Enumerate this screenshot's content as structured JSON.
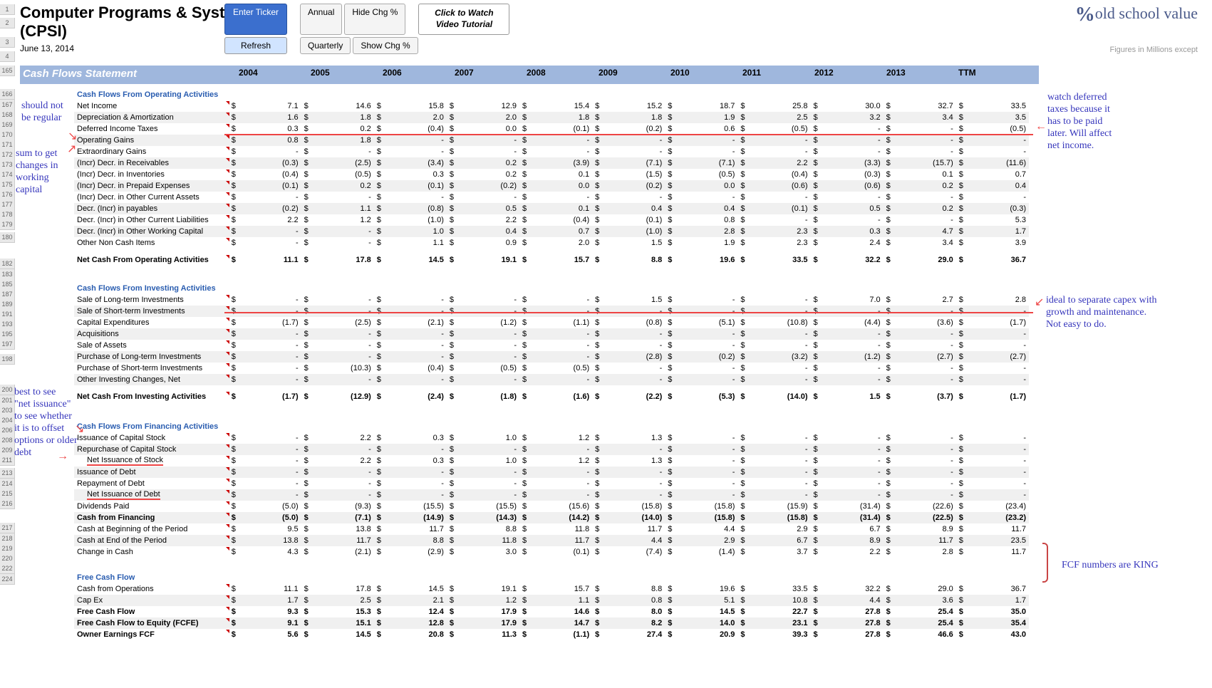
{
  "header": {
    "title": "Computer Programs & Systems Inc.",
    "ticker": "(CPSI)",
    "date": "June 13, 2014",
    "logo_text": "old school value",
    "figures": "Figures in Millions except"
  },
  "buttons": {
    "enter_ticker": "Enter Ticker",
    "refresh": "Refresh",
    "annual": "Annual",
    "quarterly": "Quarterly",
    "hide": "Hide Chg %",
    "show": "Show Chg %",
    "tutorial": "Click to Watch Video Tutorial"
  },
  "section_title": "Cash Flows Statement",
  "years": [
    "2004",
    "2005",
    "2006",
    "2007",
    "2008",
    "2009",
    "2010",
    "2011",
    "2012",
    "2013",
    "TTM"
  ],
  "sections": {
    "op_hdr": "Cash Flows From Operating Activities",
    "inv_hdr": "Cash Flows From Investing Activities",
    "fin_hdr": "Cash Flows From Financing Activities",
    "fcf_hdr": "Free Cash Flow"
  },
  "rows": {
    "net_income": {
      "label": "Net Income",
      "v": [
        "7.1",
        "14.6",
        "15.8",
        "12.9",
        "15.4",
        "15.2",
        "18.7",
        "25.8",
        "30.0",
        "32.7",
        "33.5"
      ]
    },
    "depr": {
      "label": "Depreciation & Amortization",
      "v": [
        "1.6",
        "1.8",
        "2.0",
        "2.0",
        "1.8",
        "1.8",
        "1.9",
        "2.5",
        "3.2",
        "3.4",
        "3.5"
      ]
    },
    "def_tax": {
      "label": "Deferred Income Taxes",
      "v": [
        "0.3",
        "0.2",
        "(0.4)",
        "0.0",
        "(0.1)",
        "(0.2)",
        "0.6",
        "(0.5)",
        "-",
        "-",
        "(0.5)"
      ]
    },
    "op_gains": {
      "label": "Operating Gains",
      "v": [
        "0.8",
        "1.8",
        "-",
        "-",
        "-",
        "-",
        "-",
        "-",
        "-",
        "-",
        "-"
      ]
    },
    "ext_gains": {
      "label": "Extraordinary Gains",
      "v": [
        "-",
        "-",
        "-",
        "-",
        "-",
        "-",
        "-",
        "-",
        "-",
        "-",
        "-"
      ]
    },
    "recv": {
      "label": "(Incr) Decr. in Receivables",
      "v": [
        "(0.3)",
        "(2.5)",
        "(3.4)",
        "0.2",
        "(3.9)",
        "(7.1)",
        "(7.1)",
        "2.2",
        "(3.3)",
        "(15.7)",
        "(11.6)"
      ]
    },
    "inv": {
      "label": "(Incr) Decr. in Inventories",
      "v": [
        "(0.4)",
        "(0.5)",
        "0.3",
        "0.2",
        "0.1",
        "(1.5)",
        "(0.5)",
        "(0.4)",
        "(0.3)",
        "0.1",
        "0.7"
      ]
    },
    "prep": {
      "label": "(Incr) Decr. in Prepaid Expenses",
      "v": [
        "(0.1)",
        "0.2",
        "(0.1)",
        "(0.2)",
        "0.0",
        "(0.2)",
        "0.0",
        "(0.6)",
        "(0.6)",
        "0.2",
        "0.4"
      ]
    },
    "oca": {
      "label": "(Incr) Decr. in Other Current Assets",
      "v": [
        "-",
        "-",
        "-",
        "-",
        "-",
        "-",
        "-",
        "-",
        "-",
        "-",
        "-"
      ]
    },
    "pay": {
      "label": "Decr. (Incr) in payables",
      "v": [
        "(0.2)",
        "1.1",
        "(0.8)",
        "0.5",
        "0.1",
        "0.4",
        "0.4",
        "(0.1)",
        "0.5",
        "0.2",
        "(0.3)"
      ]
    },
    "ocl": {
      "label": "Decr. (Incr) in Other Current Liabilities",
      "v": [
        "2.2",
        "1.2",
        "(1.0)",
        "2.2",
        "(0.4)",
        "(0.1)",
        "0.8",
        "-",
        "-",
        "-",
        "5.3"
      ]
    },
    "owc": {
      "label": "Decr. (Incr) in Other Working Capital",
      "v": [
        "-",
        "-",
        "1.0",
        "0.4",
        "0.7",
        "(1.0)",
        "2.8",
        "2.3",
        "0.3",
        "4.7",
        "1.7"
      ]
    },
    "onc": {
      "label": "Other Non Cash Items",
      "v": [
        "-",
        "-",
        "1.1",
        "0.9",
        "2.0",
        "1.5",
        "1.9",
        "2.3",
        "2.4",
        "3.4",
        "3.9"
      ]
    },
    "net_op": {
      "label": "Net Cash From Operating Activities",
      "v": [
        "11.1",
        "17.8",
        "14.5",
        "19.1",
        "15.7",
        "8.8",
        "19.6",
        "33.5",
        "32.2",
        "29.0",
        "36.7"
      ]
    },
    "sale_lt": {
      "label": "Sale of Long-term Investments",
      "v": [
        "-",
        "-",
        "-",
        "-",
        "-",
        "1.5",
        "-",
        "-",
        "7.0",
        "2.7",
        "2.8"
      ]
    },
    "sale_st": {
      "label": "Sale of Short-term Investments",
      "v": [
        "-",
        "-",
        "-",
        "-",
        "-",
        "-",
        "-",
        "-",
        "-",
        "-",
        "-"
      ]
    },
    "capex": {
      "label": "Capital Expenditures",
      "v": [
        "(1.7)",
        "(2.5)",
        "(2.1)",
        "(1.2)",
        "(1.1)",
        "(0.8)",
        "(5.1)",
        "(10.8)",
        "(4.4)",
        "(3.6)",
        "(1.7)"
      ]
    },
    "acq": {
      "label": "Acquisitions",
      "v": [
        "-",
        "-",
        "-",
        "-",
        "-",
        "-",
        "-",
        "-",
        "-",
        "-",
        "-"
      ]
    },
    "sale_assets": {
      "label": "Sale of Assets",
      "v": [
        "-",
        "-",
        "-",
        "-",
        "-",
        "-",
        "-",
        "-",
        "-",
        "-",
        "-"
      ]
    },
    "pur_lt": {
      "label": "Purchase of Long-term Investments",
      "v": [
        "-",
        "-",
        "-",
        "-",
        "-",
        "(2.8)",
        "(0.2)",
        "(3.2)",
        "(1.2)",
        "(2.7)",
        "(2.7)"
      ]
    },
    "pur_st": {
      "label": "Purchase of  Short-term Investments",
      "v": [
        "-",
        "(10.3)",
        "(0.4)",
        "(0.5)",
        "(0.5)",
        "-",
        "-",
        "-",
        "-",
        "-",
        "-"
      ]
    },
    "other_inv": {
      "label": "Other Investing Changes, Net",
      "v": [
        "-",
        "-",
        "-",
        "-",
        "-",
        "-",
        "-",
        "-",
        "-",
        "-",
        "-"
      ]
    },
    "net_inv": {
      "label": "Net Cash From Investing Activities",
      "v": [
        "(1.7)",
        "(12.9)",
        "(2.4)",
        "(1.8)",
        "(1.6)",
        "(2.2)",
        "(5.3)",
        "(14.0)",
        "1.5",
        "(3.7)",
        "(1.7)"
      ]
    },
    "iss_cap": {
      "label": "Issuance of Capital Stock",
      "v": [
        "-",
        "2.2",
        "0.3",
        "1.0",
        "1.2",
        "1.3",
        "-",
        "-",
        "-",
        "-",
        "-"
      ]
    },
    "rep_cap": {
      "label": "Repurchase of Capital Stock",
      "v": [
        "-",
        "-",
        "-",
        "-",
        "-",
        "-",
        "-",
        "-",
        "-",
        "-",
        "-"
      ]
    },
    "net_stock": {
      "label": "Net Issuance of Stock",
      "v": [
        "-",
        "2.2",
        "0.3",
        "1.0",
        "1.2",
        "1.3",
        "-",
        "-",
        "-",
        "-",
        "-"
      ]
    },
    "iss_debt": {
      "label": "Issuance of Debt",
      "v": [
        "-",
        "-",
        "-",
        "-",
        "-",
        "-",
        "-",
        "-",
        "-",
        "-",
        "-"
      ]
    },
    "rep_debt": {
      "label": "Repayment of Debt",
      "v": [
        "-",
        "-",
        "-",
        "-",
        "-",
        "-",
        "-",
        "-",
        "-",
        "-",
        "-"
      ]
    },
    "net_debt": {
      "label": "Net Issuance of Debt",
      "v": [
        "-",
        "-",
        "-",
        "-",
        "-",
        "-",
        "-",
        "-",
        "-",
        "-",
        "-"
      ]
    },
    "div": {
      "label": "Dividends Paid",
      "v": [
        "(5.0)",
        "(9.3)",
        "(15.5)",
        "(15.5)",
        "(15.6)",
        "(15.8)",
        "(15.8)",
        "(15.9)",
        "(31.4)",
        "(22.6)",
        "(23.4)"
      ]
    },
    "cash_fin": {
      "label": "Cash from Financing",
      "v": [
        "(5.0)",
        "(7.1)",
        "(14.9)",
        "(14.3)",
        "(14.2)",
        "(14.0)",
        "(15.8)",
        "(15.8)",
        "(31.4)",
        "(22.5)",
        "(23.2)"
      ]
    },
    "cash_beg": {
      "label": "Cash at Beginning of the Period",
      "v": [
        "9.5",
        "13.8",
        "11.7",
        "8.8",
        "11.8",
        "11.7",
        "4.4",
        "2.9",
        "6.7",
        "8.9",
        "11.7"
      ]
    },
    "cash_end": {
      "label": "Cash at End of the Period",
      "v": [
        "13.8",
        "11.7",
        "8.8",
        "11.8",
        "11.7",
        "4.4",
        "2.9",
        "6.7",
        "8.9",
        "11.7",
        "23.5"
      ]
    },
    "change": {
      "label": "Change in Cash",
      "v": [
        "4.3",
        "(2.1)",
        "(2.9)",
        "3.0",
        "(0.1)",
        "(7.4)",
        "(1.4)",
        "3.7",
        "2.2",
        "2.8",
        "11.7"
      ]
    },
    "fcf_ops": {
      "label": "Cash from Operations",
      "v": [
        "11.1",
        "17.8",
        "14.5",
        "19.1",
        "15.7",
        "8.8",
        "19.6",
        "33.5",
        "32.2",
        "29.0",
        "36.7"
      ]
    },
    "fcf_capex": {
      "label": "Cap Ex",
      "v": [
        "1.7",
        "2.5",
        "2.1",
        "1.2",
        "1.1",
        "0.8",
        "5.1",
        "10.8",
        "4.4",
        "3.6",
        "1.7"
      ]
    },
    "fcf": {
      "label": "Free Cash Flow",
      "v": [
        "9.3",
        "15.3",
        "12.4",
        "17.9",
        "14.6",
        "8.0",
        "14.5",
        "22.7",
        "27.8",
        "25.4",
        "35.0"
      ]
    },
    "fcfe": {
      "label": "Free Cash Flow to Equity (FCFE)",
      "v": [
        "9.1",
        "15.1",
        "12.8",
        "17.9",
        "14.7",
        "8.2",
        "14.0",
        "23.1",
        "27.8",
        "25.4",
        "35.4"
      ]
    },
    "owner": {
      "label": "Owner Earnings FCF",
      "v": [
        "5.6",
        "14.5",
        "20.8",
        "11.3",
        "(1.1)",
        "27.4",
        "20.9",
        "39.3",
        "27.8",
        "46.6",
        "43.0"
      ]
    }
  },
  "row_numbers": [
    "1",
    "2",
    "3",
    "4",
    "165",
    "166",
    "167",
    "168",
    "169",
    "170",
    "171",
    "172",
    "173",
    "174",
    "175",
    "176",
    "177",
    "178",
    "179",
    "180",
    "182",
    "183",
    "185",
    "187",
    "189",
    "191",
    "193",
    "195",
    "197",
    "198",
    "200",
    "201",
    "203",
    "204",
    "206",
    "208",
    "209",
    "211",
    "213",
    "214",
    "215",
    "216",
    "217",
    "218",
    "219",
    "220",
    "222",
    "224"
  ],
  "annotations": {
    "a1": "should not\nbe regular",
    "a2": "sum to get\nchanges in\nworking\ncapital",
    "a3": "best to see\n\"net issuance\"\nto see whether\nit is to offset\noptions or older\ndebt",
    "a4": "watch deferred\ntaxes because it\nhas to be paid\nlater. Will affect\nnet income.",
    "a5": "ideal to separate capex with\ngrowth and maintenance.\nNot easy to do.",
    "a6": "FCF numbers are KING"
  }
}
